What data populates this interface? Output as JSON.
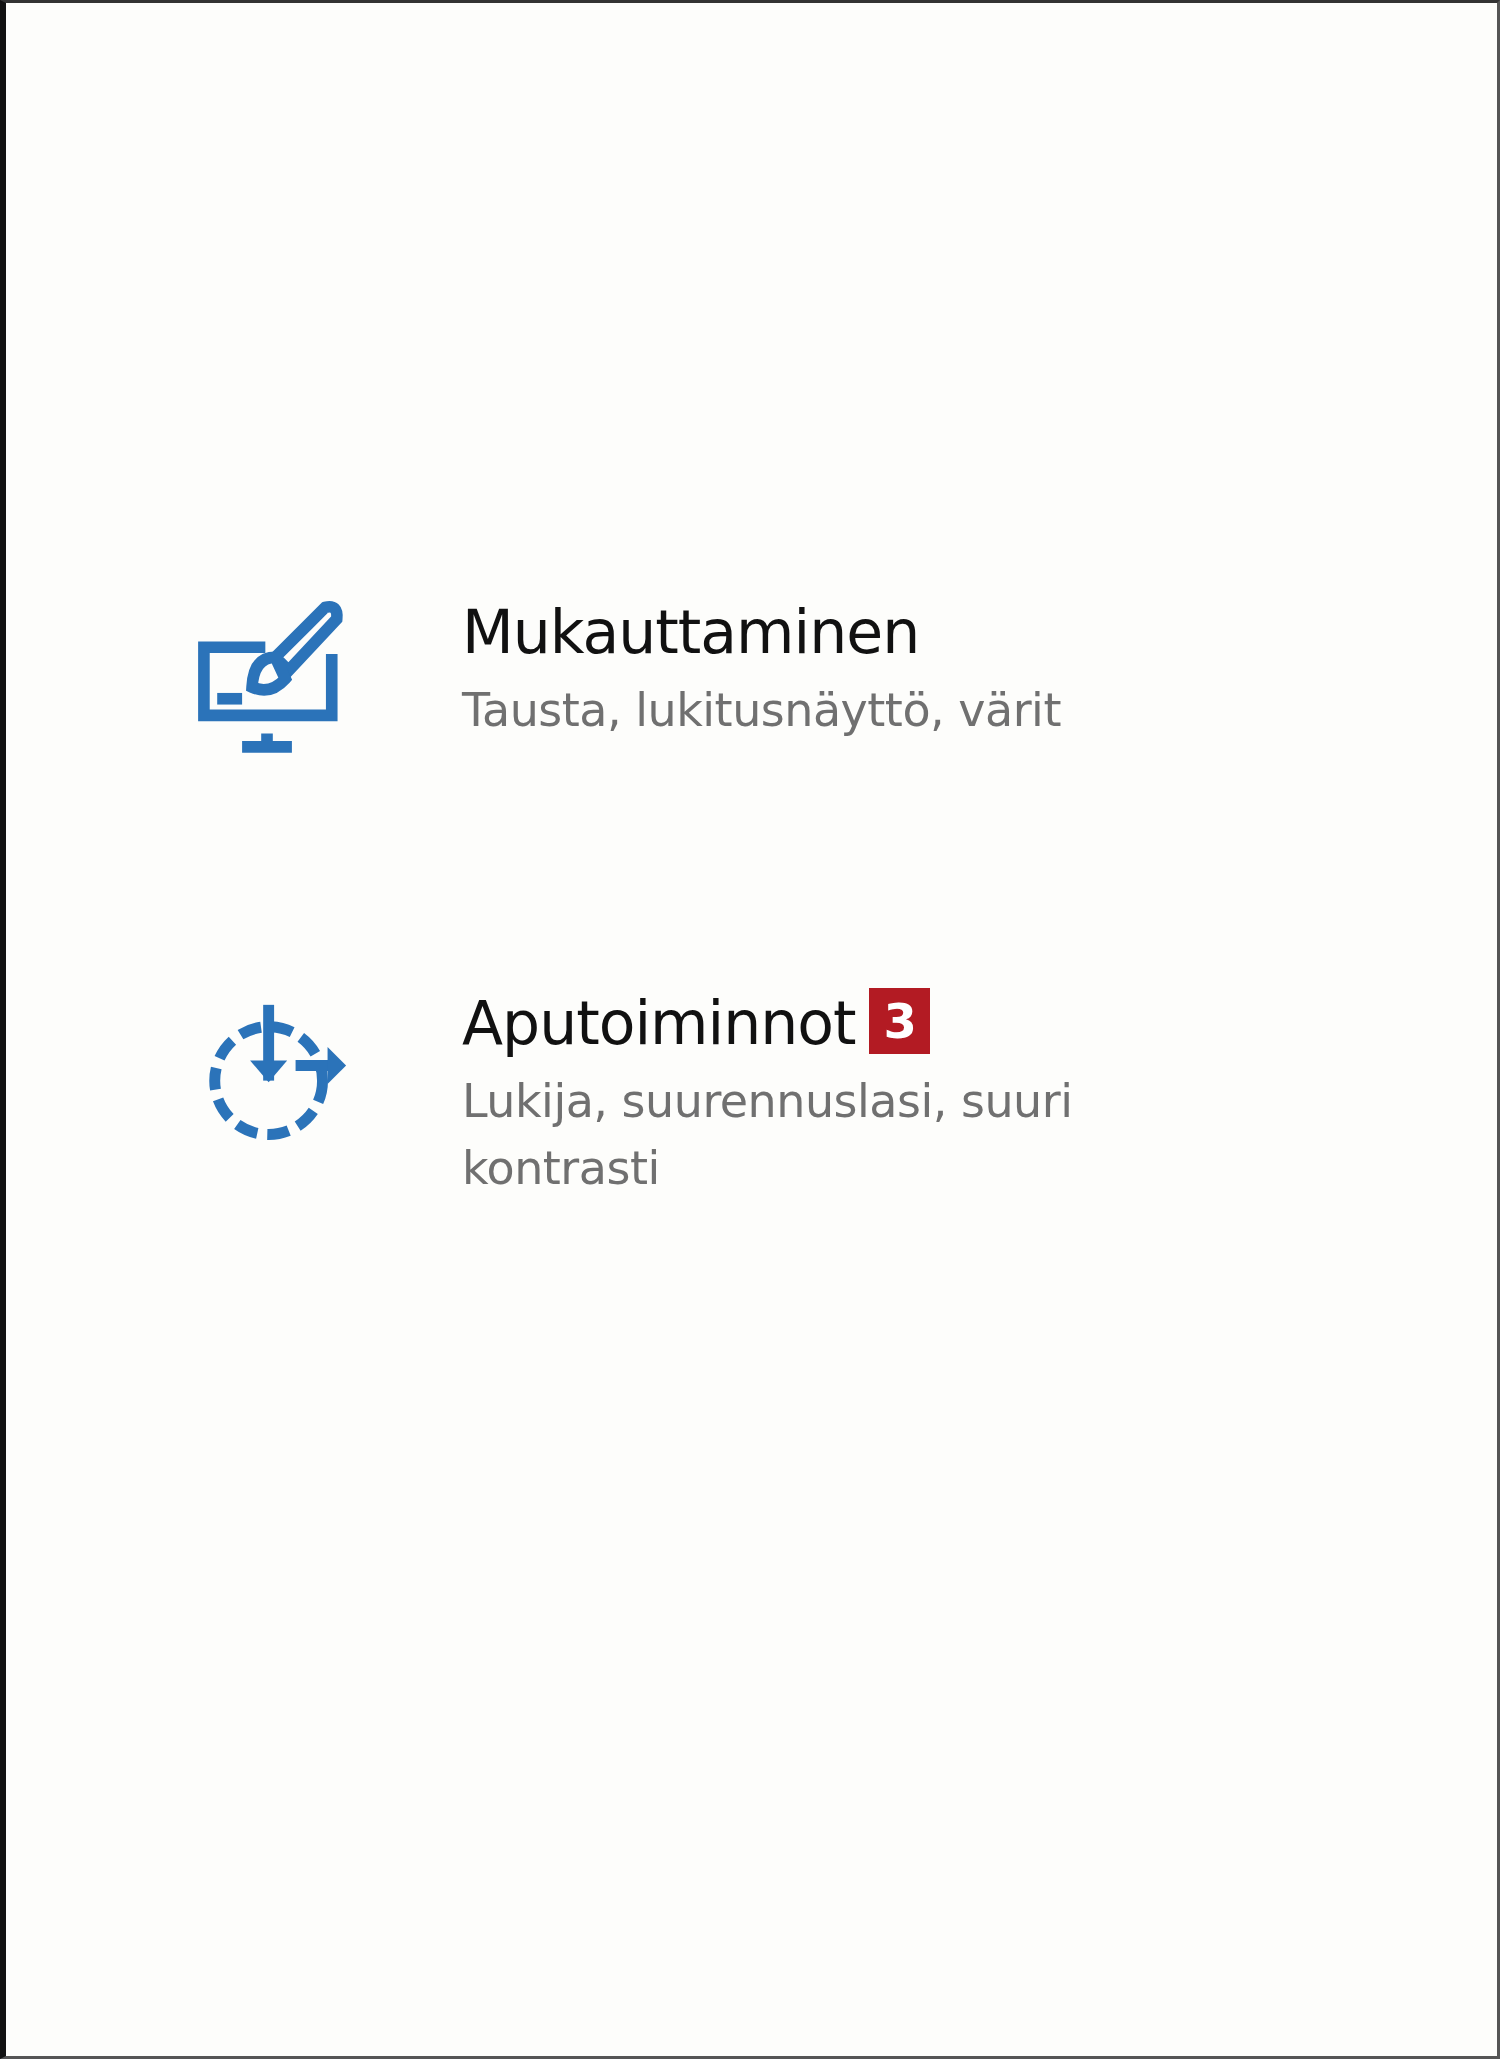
{
  "items": [
    {
      "title": "Mukauttaminen",
      "subtitle": "Tausta, lukitusnäyttö, värit"
    },
    {
      "title": "Aputoiminnot",
      "badge": "3",
      "subtitle": "Lukija, suurennuslasi, suuri kontrasti"
    }
  ]
}
